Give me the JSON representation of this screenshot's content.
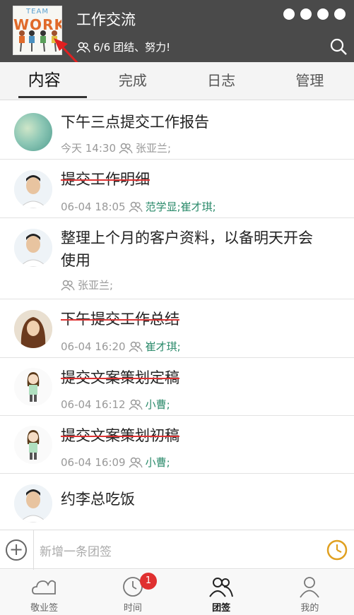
{
  "header": {
    "logo": {
      "line1": "TEAM",
      "line2": "WORK"
    },
    "title": "工作交流",
    "member_count": "6/6",
    "motto": "团结、努力!"
  },
  "tabs": [
    {
      "label": "内容",
      "active": true
    },
    {
      "label": "完成",
      "active": false
    },
    {
      "label": "日志",
      "active": false
    },
    {
      "label": "管理",
      "active": false
    }
  ],
  "items": [
    {
      "title": "下午三点提交工作报告",
      "time": "今天 14:30",
      "assignees": "张亚兰;",
      "done": false,
      "avatar": "nature"
    },
    {
      "title": "提交工作明细",
      "time": "06-04 18:05",
      "assignees": "范学显;崔才琪;",
      "done": true,
      "avatar": "man"
    },
    {
      "title": "整理上个月的客户资料，以备明天开会使用",
      "title_line1": "整理上个月的客户资料，以备明天开会",
      "title_line2": "使用",
      "time": "",
      "assignees": "张亚兰;",
      "done": false,
      "avatar": "man"
    },
    {
      "title": "下午提交工作总结",
      "time": "06-04 16:20",
      "assignees": "崔才琪;",
      "done": true,
      "avatar": "woman"
    },
    {
      "title": "提交文案策划定稿",
      "time": "06-04 16:12",
      "assignees": "小曹;",
      "done": true,
      "avatar": "cartoon"
    },
    {
      "title": "提交文案策划初稿",
      "time": "06-04 16:09",
      "assignees": "小曹;",
      "done": true,
      "avatar": "cartoon"
    },
    {
      "title": "约李总吃饭",
      "time": "",
      "assignees": "",
      "done": false,
      "avatar": "man"
    }
  ],
  "input": {
    "placeholder": "新增一条团签"
  },
  "tabbar": [
    {
      "label": "敬业签",
      "icon": "cloud-icon"
    },
    {
      "label": "时间",
      "icon": "clock-icon",
      "badge": "1"
    },
    {
      "label": "团签",
      "icon": "team-icon",
      "active": true
    },
    {
      "label": "我的",
      "icon": "person-icon"
    }
  ],
  "colors": {
    "header_bg": "#4a4a4a",
    "strike": "#dd3333",
    "assignee": "#2a8a6a",
    "badge": "#e03030",
    "clock_accent": "#e0a020"
  }
}
